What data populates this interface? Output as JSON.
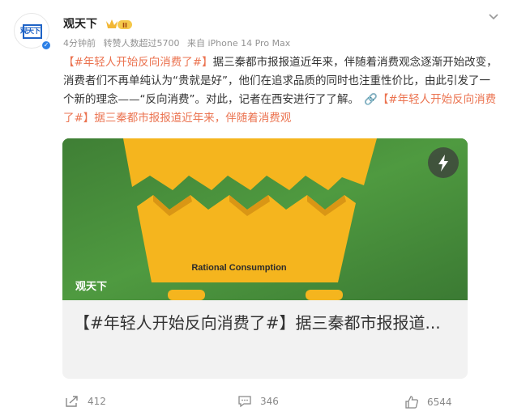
{
  "author": {
    "name": "观天下",
    "avatar_text": "观天下",
    "level_badge": "II"
  },
  "meta": {
    "time": "4分钟前",
    "reposts_note": "转赞人数超过5700",
    "source": "来自 iPhone 14 Pro Max"
  },
  "post": {
    "hashtag": "【#年轻人开始反向消费了#】",
    "body": "据三秦都市报报道近年来，伴随着消费观念逐渐开始改变，消费者们不再单纯认为“贵就是好”，他们在追求品质的同时也注重性价比，由此引发了一个新的理念——“反向消费”。对此，记者在西安进行了了解。",
    "link_icon": "link-icon",
    "link_text": "【#年轻人开始反向消费了#】据三秦都市报报道近年来，伴随着消费观"
  },
  "card": {
    "image_caption": "Rational Consumption",
    "source_label": "观天下",
    "title": "【#年轻人开始反向消费了#】据三秦都市报报道..."
  },
  "actions": {
    "repost_count": "412",
    "comment_count": "346",
    "like_count": "6544"
  },
  "colors": {
    "hashtag": "#eb7350",
    "image_bg": "#4b8c3c",
    "cart": "#f5b51e"
  }
}
